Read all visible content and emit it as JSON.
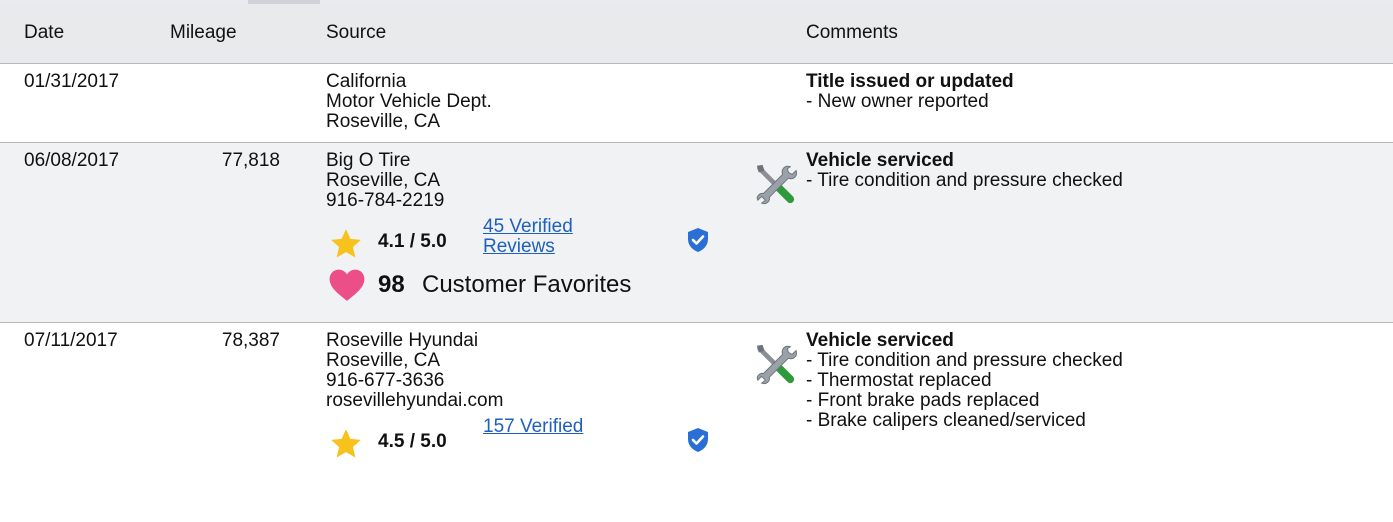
{
  "table": {
    "headers": {
      "date": "Date",
      "mileage": "Mileage",
      "source": "Source",
      "comments": "Comments"
    },
    "rows": [
      {
        "date": "01/31/2017",
        "mileage": "",
        "source_lines": [
          "California",
          "Motor Vehicle Dept.",
          "Roseville, CA"
        ],
        "comment_title": "Title issued or updated",
        "comment_lines": [
          "- New owner reported"
        ]
      },
      {
        "date": "06/08/2017",
        "mileage": "77,818",
        "source_lines": [
          "Big O Tire",
          "Roseville, CA",
          "916-784-2219"
        ],
        "rating": "4.1 / 5.0",
        "reviews_link": "45 Verified Reviews",
        "favorites_count": "98",
        "favorites_label": "Customer Favorites",
        "comment_title": "Vehicle serviced",
        "comment_lines": [
          "- Tire condition and pressure checked"
        ]
      },
      {
        "date": "07/11/2017",
        "mileage": "78,387",
        "source_lines": [
          "Roseville Hyundai",
          "Roseville, CA",
          "916-677-3636",
          "rosevillehyundai.com"
        ],
        "rating": "4.5 / 5.0",
        "reviews_link": "157 Verified",
        "comment_title": "Vehicle serviced",
        "comment_lines": [
          "- Tire condition and pressure checked",
          "- Thermostat replaced",
          "- Front brake pads replaced",
          "- Brake calipers cleaned/serviced"
        ]
      }
    ]
  },
  "icons": {
    "star": "star-icon",
    "heart": "heart-icon",
    "shield": "verified-shield-icon",
    "tools": "wrench-screwdriver-icon"
  },
  "colors": {
    "link": "#1f5fbf",
    "star": "#f7c21b",
    "heart": "#ec4f87",
    "shield": "#2a6fd6",
    "header_bg": "#e8eaec",
    "alt_row_bg": "#f1f2f3"
  }
}
